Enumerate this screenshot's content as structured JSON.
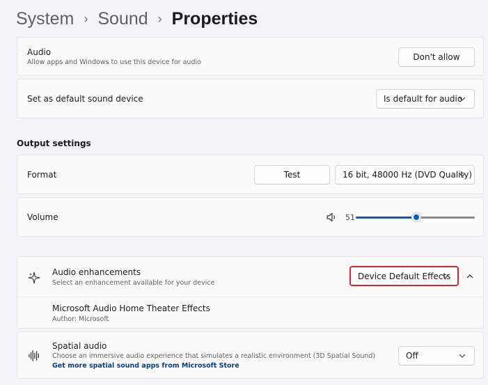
{
  "breadcrumb": {
    "items": [
      "System",
      "Sound"
    ],
    "current": "Properties",
    "separator": "›"
  },
  "audio_row": {
    "title": "Audio",
    "subtitle": "Allow apps and Windows to use this device for audio",
    "button_label": "Don't allow"
  },
  "default_device_row": {
    "title": "Set as default sound device",
    "dropdown_value": "Is default for audio"
  },
  "output_settings": {
    "heading": "Output settings",
    "format": {
      "title": "Format",
      "test_label": "Test",
      "format_value": "16 bit, 48000 Hz (DVD Quality)"
    },
    "volume": {
      "title": "Volume",
      "value": "51",
      "level": 0.51
    }
  },
  "enhancements": {
    "title": "Audio enhancements",
    "subtitle": "Select an enhancement available for your device",
    "dropdown_value": "Device Default Effects",
    "effect_name": "Microsoft Audio Home Theater Effects",
    "effect_author": "Author: Microsoft"
  },
  "spatial_audio": {
    "title": "Spatial audio",
    "subtitle": "Choose an immersive audio experience that simulates a realistic environment (3D Spatial Sound)",
    "link": "Get more spatial sound apps from Microsoft Store",
    "dropdown_value": "Off"
  },
  "colors": {
    "accent": "#005fb8",
    "highlight_border": "#d9232d",
    "background": "#f3f5f8",
    "card": "#fbfbfb"
  },
  "icons": {
    "volume": "speaker-icon",
    "enhancements": "sparkle-icon",
    "spatial": "waveform-icon",
    "chevron_down": "chevron-down-icon",
    "chevron_up": "chevron-up-icon"
  }
}
